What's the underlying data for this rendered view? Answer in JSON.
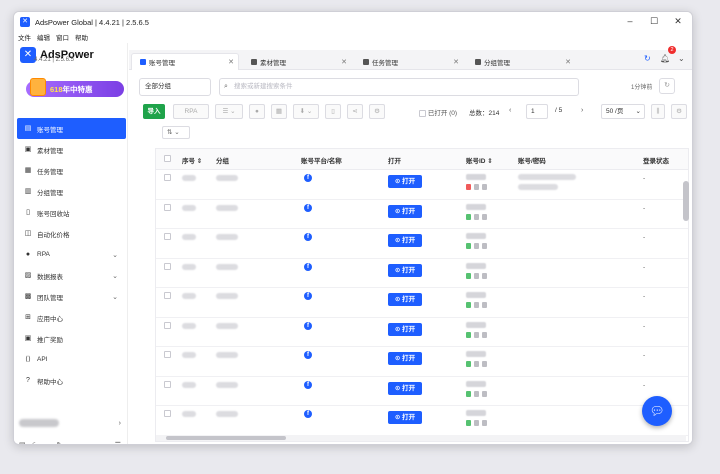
{
  "window": {
    "title": "AdsPower Global | 4.4.21 | 2.5.6.5"
  },
  "menu": [
    "文件",
    "编辑",
    "窗口",
    "帮助"
  ],
  "brand": {
    "name": "AdsPower",
    "version": "4.4.21 | 2.5.6.5"
  },
  "promo": {
    "text_a": "618",
    "text_b": "年中特惠"
  },
  "sidebar": {
    "items": [
      {
        "label": "账号管理",
        "icon": "user-icon",
        "active": true
      },
      {
        "label": "素材管理",
        "icon": "folder-icon"
      },
      {
        "label": "任务管理",
        "icon": "task-icon"
      },
      {
        "label": "分组管理",
        "icon": "group-icon"
      },
      {
        "label": "账号回收站",
        "icon": "trash-icon"
      },
      {
        "label": "自动化价格",
        "icon": "price-icon"
      },
      {
        "label": "RPA",
        "icon": "robot-icon",
        "chevron": true
      },
      {
        "label": "数据报表",
        "icon": "chart-icon",
        "chevron": true
      },
      {
        "label": "团队管理",
        "icon": "team-icon",
        "chevron": true
      },
      {
        "label": "应用中心",
        "icon": "apps-icon"
      },
      {
        "label": "推广奖励",
        "icon": "gift-icon"
      },
      {
        "label": "API",
        "icon": "api-icon"
      },
      {
        "label": "帮助中心",
        "icon": "help-icon"
      }
    ]
  },
  "tabs": [
    {
      "label": "账号管理",
      "active": true
    },
    {
      "label": "素材管理"
    },
    {
      "label": "任务管理"
    },
    {
      "label": "分组管理"
    }
  ],
  "notifications": {
    "count": "2"
  },
  "filters": {
    "group_select": "全部分组",
    "search_placeholder": "搜索或新建搜索条件",
    "refresh_text": "1分钟前"
  },
  "toolbar": {
    "import_label": "导入",
    "rpa_label": "RPA",
    "opened_label": "已打开 (0)",
    "total_label": "总数：214",
    "page_current": "1",
    "page_total": "/ 5",
    "per_page": "50 /页"
  },
  "table": {
    "headers": {
      "seq": "序号",
      "group": "分组",
      "platform": "账号平台/名称",
      "open": "打开",
      "id": "账号ID",
      "password": "账号/密码",
      "login": "登录状态"
    },
    "open_button": "打开",
    "login_status": "-",
    "row_count": 9
  },
  "colors": {
    "accent": "#1e5eff",
    "import": "#1fa34a",
    "badge": "#f02d2d"
  }
}
